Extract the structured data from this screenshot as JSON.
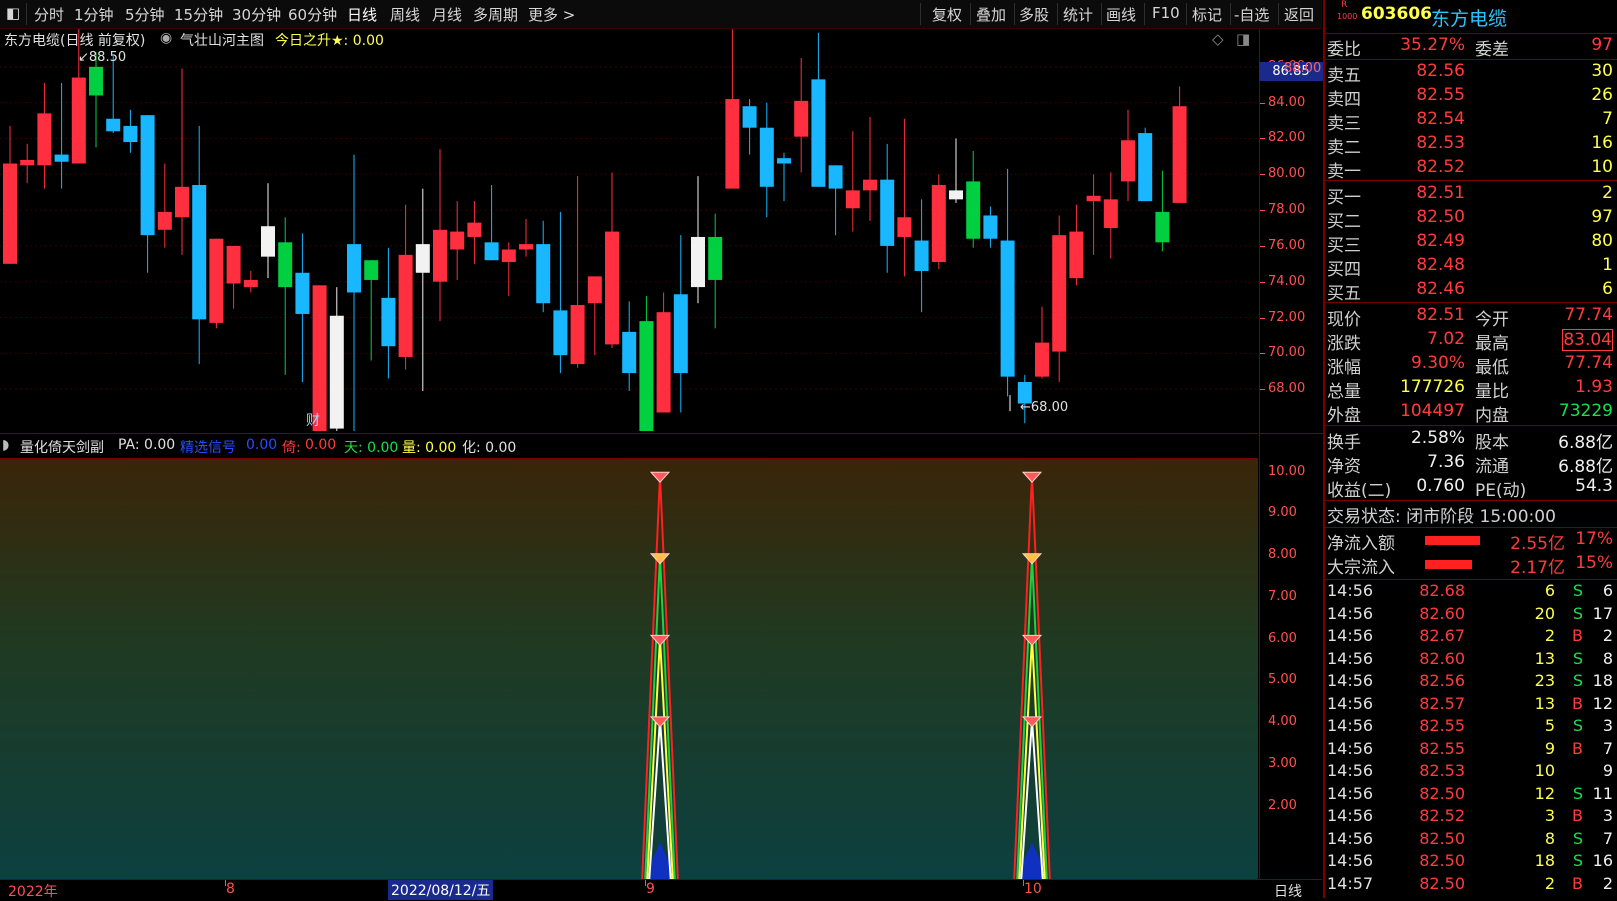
{
  "toolbar": {
    "periods": [
      "分时",
      "1分钟",
      "5分钟",
      "15分钟",
      "30分钟",
      "60分钟",
      "日线",
      "周线",
      "月线",
      "多周期",
      "更多 >"
    ],
    "active_period": "日线",
    "right_tools": [
      "复权",
      "叠加",
      "多股",
      "统计",
      "画线",
      "F10",
      "标记",
      "-自选",
      "返回"
    ]
  },
  "stock": {
    "code": "603606",
    "name": "东方电缆",
    "badge_r": "R",
    "badge_num": "1000"
  },
  "chart": {
    "title": "东方电缆(日线 前复权)",
    "main_indicator": "气壮山河主图",
    "rise_label": "今日之升★: 0.00",
    "current_price_tag": "86.85",
    "high_marker": "88.50",
    "low_marker": "68.00",
    "cai_marker": "财",
    "price_ticks": [
      "86.00",
      "84.00",
      "82.00",
      "80.00",
      "78.00",
      "76.00",
      "74.00",
      "72.00",
      "70.00",
      "68.00"
    ],
    "price_top_tick": "88.00",
    "candles": [
      [
        75,
        80.6,
        82.7,
        76.8,
        "r"
      ],
      [
        80.5,
        80.8,
        81.7,
        79.5,
        "r"
      ],
      [
        80.5,
        83.4,
        85.1,
        79.2,
        "r"
      ],
      [
        80.7,
        81.1,
        85.1,
        79.2,
        "c"
      ],
      [
        80.6,
        85.4,
        89.3,
        81.8,
        "r"
      ],
      [
        84.4,
        86,
        86.8,
        81.5,
        "g"
      ],
      [
        82.4,
        83.1,
        86.6,
        82.3,
        "c"
      ],
      [
        81.8,
        82.7,
        83.6,
        81.2,
        "c"
      ],
      [
        83.3,
        76.6,
        82.9,
        74.5,
        "c"
      ],
      [
        76.9,
        77.9,
        80.6,
        75.9,
        "r"
      ],
      [
        77.6,
        79.3,
        85.9,
        75.5,
        "r"
      ],
      [
        79.4,
        71.9,
        82.7,
        69.4,
        "c"
      ],
      [
        71.7,
        76.4,
        75.9,
        71.4,
        "r"
      ],
      [
        73.9,
        76,
        75.3,
        72.5,
        "r"
      ],
      [
        73.7,
        74.1,
        74.6,
        73.4,
        "r"
      ],
      [
        75.4,
        77.1,
        79.5,
        74.2,
        "w"
      ],
      [
        73.7,
        76.2,
        77.6,
        68.8,
        "g"
      ],
      [
        74.5,
        72.2,
        76.7,
        68.4,
        "c"
      ],
      [
        73.8,
        63.6,
        73.6,
        63.7,
        "r"
      ],
      [
        65.8,
        72.1,
        73.7,
        63.9,
        "w"
      ],
      [
        73.4,
        76.1,
        81.1,
        64.1,
        "c"
      ],
      [
        74.1,
        75.2,
        74.4,
        69.6,
        "g"
      ],
      [
        73.1,
        70.4,
        75.9,
        68.6,
        "c"
      ],
      [
        69.8,
        75.5,
        78.3,
        69.1,
        "r"
      ],
      [
        74.5,
        76.1,
        79.2,
        67.9,
        "w"
      ],
      [
        74,
        76.9,
        81.4,
        71.8,
        "r"
      ],
      [
        75.8,
        76.8,
        78.5,
        74.1,
        "r"
      ],
      [
        76.5,
        77.3,
        78.5,
        75
      ],
      [
        76.2,
        75.2,
        79.4,
        75.7,
        "c"
      ],
      [
        75.1,
        75.8,
        76.2,
        73.2,
        "r"
      ],
      [
        75.8,
        76.1,
        77.5,
        75.4,
        "r"
      ],
      [
        72.8,
        76.1,
        77.4,
        72.3,
        "c"
      ],
      [
        72.4,
        69.9,
        77.9,
        68.9,
        "c"
      ],
      [
        69.4,
        72.7,
        79.9,
        69.2,
        "r"
      ],
      [
        72.8,
        74.3,
        72.9,
        69.9,
        "r"
      ],
      [
        70.5,
        76.8,
        80.1,
        70.3,
        "r"
      ],
      [
        71.2,
        68.9,
        72.9,
        67.9,
        "c"
      ],
      [
        71.8,
        65.6,
        73.2,
        63.9,
        "g"
      ],
      [
        66.7,
        72.3,
        73.4,
        66.7,
        "r"
      ],
      [
        68.9,
        73.3,
        76.6,
        66.7,
        "c"
      ],
      [
        73.7,
        76.5,
        79.9,
        72.8,
        "w"
      ],
      [
        76.5,
        74.1,
        77.8,
        71.4,
        "g"
      ],
      [
        79.2,
        84.2,
        88.1,
        80.5,
        "r"
      ],
      [
        83.8,
        82.6,
        84.2,
        81.1,
        "c"
      ],
      [
        82.6,
        79.3,
        84,
        77.6,
        "c"
      ],
      [
        80.9,
        80.6,
        81.2,
        78.5,
        "c"
      ],
      [
        82.1,
        84.1,
        86.5,
        80.1,
        "r"
      ],
      [
        79.3,
        85.3,
        87.9,
        82.9,
        "c"
      ],
      [
        80.5,
        79.2,
        80.5,
        76.6,
        "c"
      ],
      [
        78.1,
        79.1,
        82.4,
        76.8,
        "r"
      ],
      [
        79.7,
        79.1,
        83.2,
        77.4,
        "r"
      ],
      [
        79.7,
        76,
        81.7,
        74.5,
        "c"
      ],
      [
        76.5,
        77.6,
        83.1,
        74.3,
        "r"
      ],
      [
        76.3,
        74.6,
        78.6,
        72.3,
        "c"
      ],
      [
        75.1,
        79.4,
        80,
        74.7,
        "r"
      ],
      [
        78.6,
        79.1,
        82,
        78.4,
        "w"
      ],
      [
        76.4,
        79.6,
        81.3,
        75.9,
        "g"
      ],
      [
        76.4,
        77.7,
        78.2,
        75.9,
        "c"
      ],
      [
        76.3,
        68.7,
        80.3,
        67.6,
        "c"
      ],
      [
        68.4,
        67.2,
        68.8,
        66.1,
        "c"
      ],
      [
        68.7,
        70.6,
        72.6,
        68.6,
        "r"
      ],
      [
        70.1,
        76.6,
        77.7,
        68.4,
        "r"
      ],
      [
        74.2,
        76.8,
        78.3,
        73.8,
        "r"
      ],
      [
        78.5,
        78.8,
        80,
        75.5,
        "r"
      ],
      [
        78.6,
        77,
        80.1,
        75.3,
        "r"
      ],
      [
        79.6,
        81.9,
        83.6,
        78.5,
        "r"
      ],
      [
        78.5,
        82.3,
        82.6,
        78.5,
        "c"
      ],
      [
        76.2,
        77.9,
        80.2,
        75.7,
        "g"
      ],
      [
        78.4,
        83.8,
        84.9,
        78.4,
        "r"
      ]
    ]
  },
  "indicator": {
    "name": "量化倚天剑副",
    "pa": "PA: 0.00",
    "signal_label": "精选信号",
    "signal_value": "0.00",
    "yi_label": "倚:",
    "yi_value": "0.00",
    "tian": "天: 0.00",
    "liang": "量: 0.00",
    "hua": "化: 0.00",
    "ticks": [
      "10.00",
      "9.00",
      "8.00",
      "7.00",
      "6.00",
      "5.00",
      "4.00",
      "3.00",
      "2.00"
    ],
    "spikes": [
      660,
      1032
    ]
  },
  "date_axis": {
    "labels": [
      "2022年",
      "8",
      "2022/08/12/五",
      "9",
      "10"
    ],
    "period_label": "日线"
  },
  "panel": {
    "weibi_label": "委比",
    "weibi_value": "35.27%",
    "weicha_label": "委差",
    "weicha_value": "97",
    "sell": [
      {
        "label": "卖五",
        "price": "82.56",
        "vol": "30"
      },
      {
        "label": "卖四",
        "price": "82.55",
        "vol": "26"
      },
      {
        "label": "卖三",
        "price": "82.54",
        "vol": "7"
      },
      {
        "label": "卖二",
        "price": "82.53",
        "vol": "16"
      },
      {
        "label": "卖一",
        "price": "82.52",
        "vol": "10"
      }
    ],
    "buy": [
      {
        "label": "买一",
        "price": "82.51",
        "vol": "2"
      },
      {
        "label": "买二",
        "price": "82.50",
        "vol": "97"
      },
      {
        "label": "买三",
        "price": "82.49",
        "vol": "80"
      },
      {
        "label": "买四",
        "price": "82.48",
        "vol": "1"
      },
      {
        "label": "买五",
        "price": "82.46",
        "vol": "6"
      }
    ],
    "quote": [
      {
        "l1": "现价",
        "v1": "82.51",
        "c1": "red",
        "l2": "今开",
        "v2": "77.74",
        "c2": "red"
      },
      {
        "l1": "涨跌",
        "v1": "7.02",
        "c1": "red",
        "l2": "最高",
        "v2": "83.04",
        "c2": "red"
      },
      {
        "l1": "涨幅",
        "v1": "9.30%",
        "c1": "red",
        "l2": "最低",
        "v2": "77.74",
        "c2": "red"
      },
      {
        "l1": "总量",
        "v1": "177726",
        "c1": "yellow",
        "l2": "量比",
        "v2": "1.93",
        "c2": "red"
      },
      {
        "l1": "外盘",
        "v1": "104497",
        "c1": "red",
        "l2": "内盘",
        "v2": "73229",
        "c2": "green"
      }
    ],
    "fund": [
      {
        "l1": "换手",
        "v1": "2.58%",
        "l2": "股本",
        "v2": "6.88亿"
      },
      {
        "l1": "净资",
        "v1": "7.36",
        "l2": "流通",
        "v2": "6.88亿"
      },
      {
        "l1": "收益(二)",
        "v1": "0.760",
        "l2": "PE(动)",
        "v2": "54.3"
      }
    ],
    "status": "交易状态: 闭市阶段 15:00:00",
    "flows": [
      {
        "label": "净流入额",
        "value": "2.55亿",
        "pct": "17%",
        "bar": 0.55
      },
      {
        "label": "大宗流入",
        "value": "2.17亿",
        "pct": "15%",
        "bar": 0.47
      }
    ],
    "trades": [
      {
        "t": "14:56",
        "p": "82.68",
        "v": "6",
        "s": "S",
        "n": "6"
      },
      {
        "t": "14:56",
        "p": "82.60",
        "v": "20",
        "s": "S",
        "n": "17"
      },
      {
        "t": "14:56",
        "p": "82.67",
        "v": "2",
        "s": "B",
        "n": "2"
      },
      {
        "t": "14:56",
        "p": "82.60",
        "v": "13",
        "s": "S",
        "n": "8"
      },
      {
        "t": "14:56",
        "p": "82.56",
        "v": "23",
        "s": "S",
        "n": "18"
      },
      {
        "t": "14:56",
        "p": "82.57",
        "v": "13",
        "s": "B",
        "n": "12"
      },
      {
        "t": "14:56",
        "p": "82.55",
        "v": "5",
        "s": "S",
        "n": "3"
      },
      {
        "t": "14:56",
        "p": "82.55",
        "v": "9",
        "s": "B",
        "n": "7"
      },
      {
        "t": "14:56",
        "p": "82.53",
        "v": "10",
        "s": "",
        "n": "9"
      },
      {
        "t": "14:56",
        "p": "82.50",
        "v": "12",
        "s": "S",
        "n": "11"
      },
      {
        "t": "14:56",
        "p": "82.52",
        "v": "3",
        "s": "B",
        "n": "3"
      },
      {
        "t": "14:56",
        "p": "82.50",
        "v": "8",
        "s": "S",
        "n": "7"
      },
      {
        "t": "14:56",
        "p": "82.50",
        "v": "18",
        "s": "S",
        "n": "16"
      },
      {
        "t": "14:57",
        "p": "82.50",
        "v": "2",
        "s": "B",
        "n": "2"
      }
    ]
  }
}
